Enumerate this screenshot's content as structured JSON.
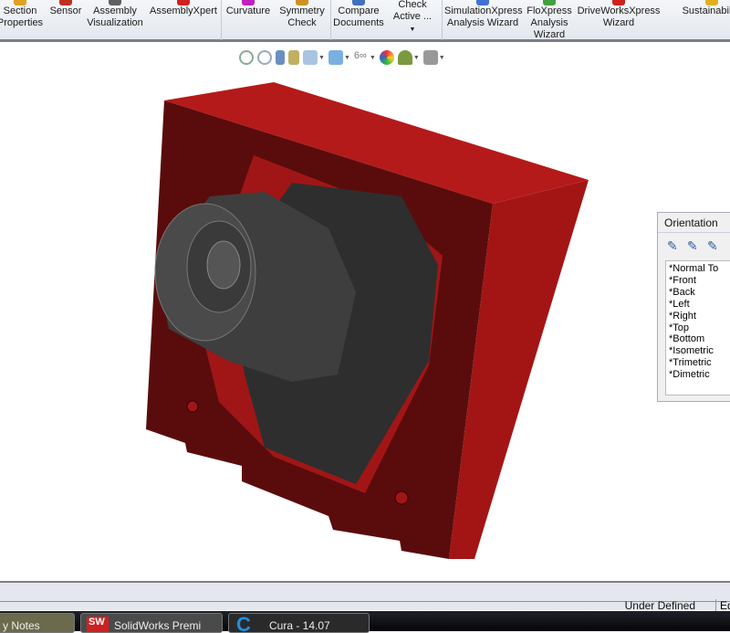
{
  "ribbon": {
    "buttons": [
      {
        "label": "Section Properties",
        "color": "#e0a020"
      },
      {
        "label": "Sensor",
        "color": "#c03020"
      },
      {
        "label": "Assembly Visualization",
        "color": "#606060"
      },
      {
        "label": "AssemblyXpert",
        "color": "#d02020"
      },
      {
        "label": "Curvature",
        "color": "#c020c0"
      },
      {
        "label": "Symmetry Check",
        "color": "#d09020"
      },
      {
        "label": "Compare Documents",
        "color": "#4070c0"
      },
      {
        "label": "Check Active ...",
        "color": "#e8eaee"
      },
      {
        "label": "SimulationXpress Analysis Wizard",
        "color": "#4070d0"
      },
      {
        "label": "FloXpress Analysis Wizard",
        "color": "#40a040"
      },
      {
        "label": "DriveWorksXpress Wizard",
        "color": "#d02020"
      },
      {
        "label": "Sustainability",
        "color": "#e0b020"
      }
    ]
  },
  "view_toolbar": [
    "zoom-to-fit-icon",
    "zoom-to-area-icon",
    "previous-view-icon",
    "section-view-icon",
    "view-orientation-icon",
    "display-style-icon",
    "hide-show-items-icon",
    "edit-appearance-icon",
    "apply-scene-icon",
    "view-settings-icon"
  ],
  "orientation": {
    "title": "Orientation",
    "items": [
      "*Normal To",
      "*Front",
      "*Back",
      "*Left",
      "*Right",
      "*Top",
      "*Bottom",
      "*Isometric",
      "*Trimetric",
      "*Dimetric"
    ]
  },
  "status": {
    "state": "Under Defined",
    "mode": "Edi"
  },
  "taskbar": [
    {
      "label": "y Notes"
    },
    {
      "label": "SolidWorks Premi"
    },
    {
      "label": "Cura - 14.07"
    }
  ]
}
